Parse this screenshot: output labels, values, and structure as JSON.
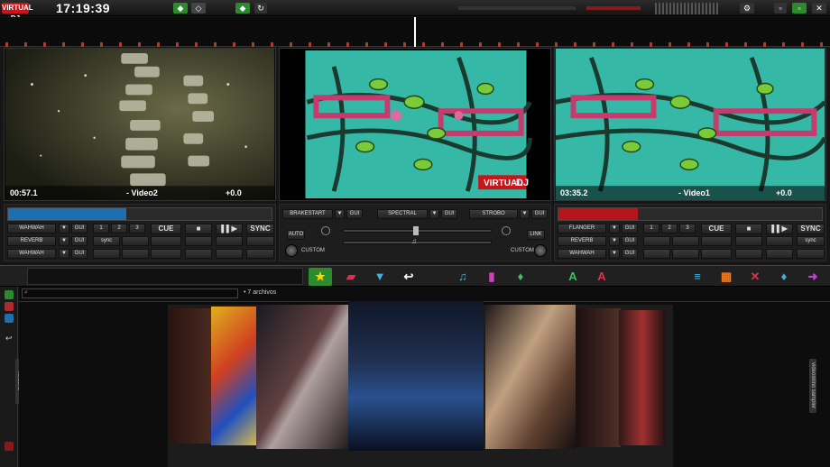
{
  "top": {
    "logo_text": "VIRTUAL DJ",
    "clock": "17:19:39"
  },
  "decks": {
    "left": {
      "time": "00:57.1",
      "title": "- Video2",
      "pitch": "+0.0",
      "progress": 0.45,
      "progress_color": "#1e6fb0"
    },
    "right": {
      "time": "03:35.2",
      "title": "- Video1",
      "pitch": "+0.0",
      "progress": 0.3,
      "progress_color": "#b8151b"
    }
  },
  "center": {
    "watermark_a": "VIRTUAL",
    "watermark_b": "DJ"
  },
  "left_fx": [
    "WAHWAH",
    "REVERB",
    "WAHWAH"
  ],
  "right_fx": [
    "FLANGER",
    "REVERB",
    "WAHWAH"
  ],
  "gui": "GUI",
  "sync_small": "sync",
  "hotcues": [
    "1",
    "2",
    "3"
  ],
  "cue": "CUE",
  "stop": "■",
  "playpause": "▌▌▶",
  "sync": "SYNC",
  "mixer": {
    "fx1": "BRAKESTART",
    "fx2": "SPECTRAL",
    "fx3": "STROBO",
    "auto": "AUTO",
    "link": "LINK",
    "custom": "CUSTOM"
  },
  "browser": {
    "file_count": "• 7 archivos",
    "folders_tab": "folders",
    "right_tab": "videoskins sampler"
  },
  "colors": {
    "accent_red": "#c8141a",
    "accent_blue": "#1e6fb0"
  }
}
